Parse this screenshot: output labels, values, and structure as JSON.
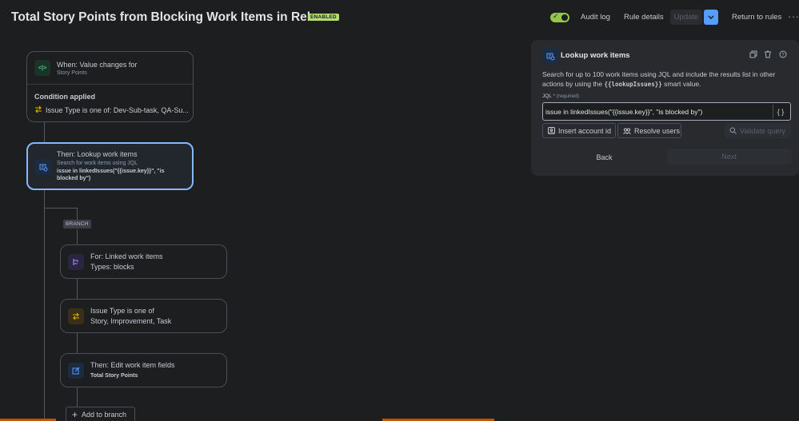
{
  "header": {
    "title": "Total Story Points from Blocking Work Items in Release",
    "status_badge": "ENABLED",
    "audit_log": "Audit log",
    "rule_details": "Rule details",
    "update": "Update",
    "update_dropdown_icon": "chevron-down-icon",
    "return_to_rules": "Return to rules",
    "more": "···"
  },
  "flow": {
    "trigger": {
      "title": "When: Value changes for",
      "subtitle": "Story Points",
      "icon_glyph": "<|>",
      "condition_label": "Condition applied",
      "condition_text": "Issue Type is one of: Dev-Sub-task, QA-Su..."
    },
    "lookup": {
      "title": "Then: Lookup work items",
      "subtitle": "Search for work items using JQL",
      "detail_line1": "issue in linkedIssues(\"{{issue.key}}\", \"is",
      "detail_line2": "blocked by\")"
    },
    "branch_tag": "BRANCH",
    "branch_items": [
      {
        "title": "For: Linked work items",
        "detail": "Types: blocks",
        "icon": "branch-icon",
        "color": "#9f8fef"
      },
      {
        "title": "Issue Type is one of",
        "detail": "Story, Improvement, Task",
        "icon": "condition-icon",
        "color": "#e2b203"
      },
      {
        "title": "Then: Edit work item fields",
        "detail": "Total Story Points",
        "icon": "edit-icon",
        "color": "#579dff"
      }
    ],
    "add_to_branch": "Add to branch"
  },
  "panel": {
    "title": "Lookup work items",
    "description_part1": "Search for up to 100 work items using JQL and include the results list in other actions by using the ",
    "smart_value": "{{lookupIssues}}",
    "description_part2": " smart value.",
    "jql_label": "JQL",
    "required_star": "*",
    "required_text": "(required)",
    "jql_value": "issue in linkedIssues(\"{{issue.key}}\", \"is blocked by\")",
    "braces": "{ }",
    "insert_account_id": "Insert account id",
    "resolve_users": "Resolve users",
    "validate_query": "Validate query",
    "back": "Back",
    "next": "Next"
  },
  "colors": {
    "accent": "#579dff",
    "enabled_green": "#94c748",
    "selected_border": "#85b8ff"
  }
}
